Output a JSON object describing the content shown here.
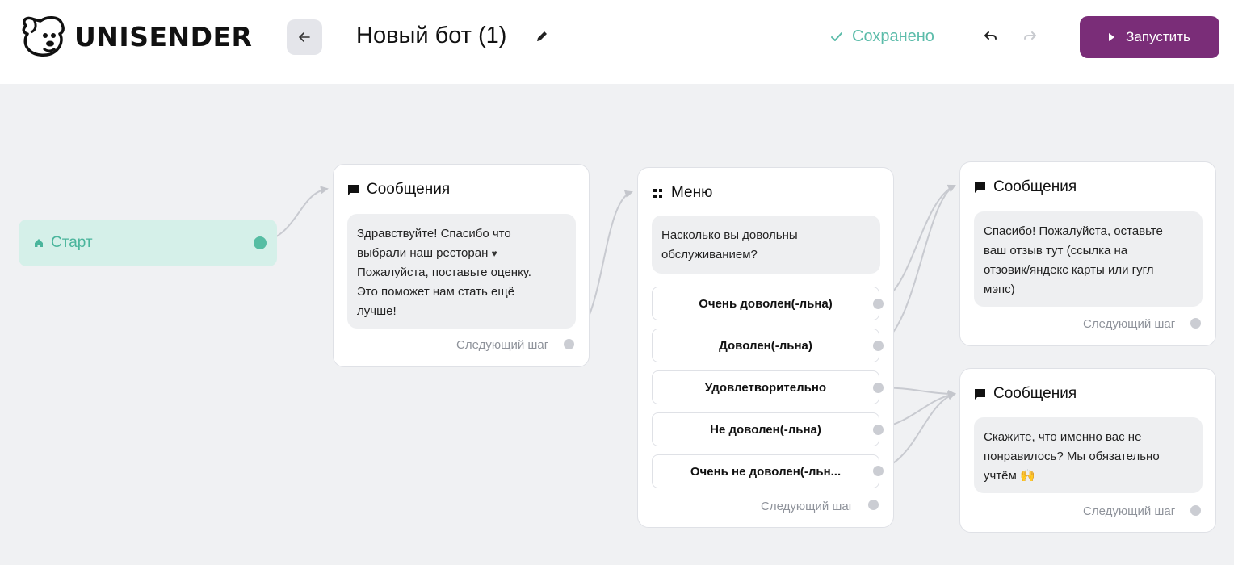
{
  "header": {
    "logo_text": "UNISENDER",
    "bot_title": "Новый бот (1)",
    "saved_status": "Сохранено",
    "run_label": "Запустить",
    "colors": {
      "accent": "#7a2d78",
      "saved": "#5cbcaa"
    }
  },
  "canvas": {
    "start_label": "Старт",
    "next_step_label": "Следующий шаг",
    "msg1": {
      "title": "Сообщения",
      "lines": [
        "Здравствуйте! Спасибо что",
        "выбрали наш ресторан",
        "Пожалуйста, поставьте оценку.",
        "Это поможет нам стать ещё",
        "лучше!"
      ]
    },
    "menu": {
      "title": "Меню",
      "question_lines": [
        "Насколько вы довольны",
        "обслуживанием?"
      ],
      "options": [
        "Очень доволен(-льна)",
        "Доволен(-льна)",
        "Удовлетворительно",
        "Не доволен(-льна)",
        "Очень не доволен(-льн..."
      ]
    },
    "msg2": {
      "title": "Сообщения",
      "lines": [
        "Спасибо! Пожалуйста, оставьте",
        "ваш отзыв тут (ссылка на",
        "отзовик/яндекс карты или гугл",
        "мэпс)"
      ]
    },
    "msg3": {
      "title": "Сообщения",
      "lines": [
        "Скажите, что именно вас не",
        "понравилось? Мы обязательно",
        "учтём"
      ]
    }
  }
}
